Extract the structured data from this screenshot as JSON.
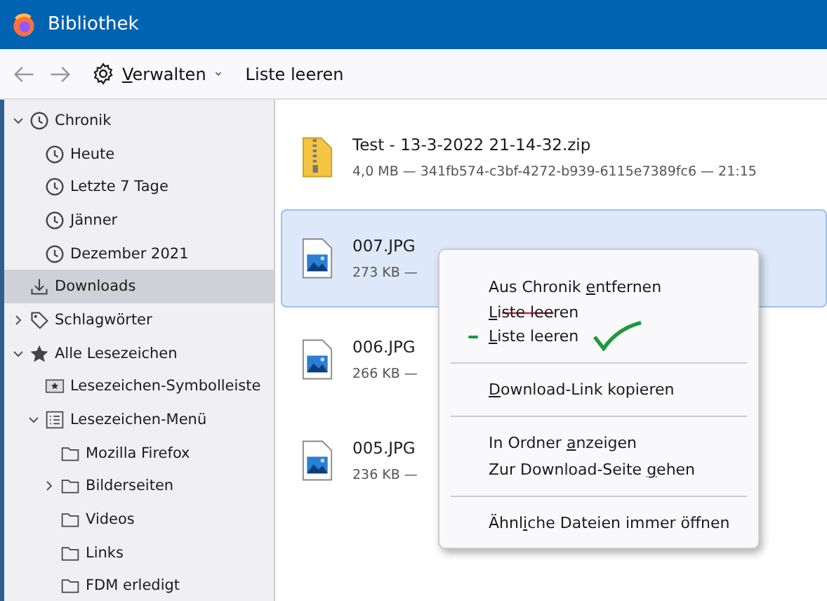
{
  "window": {
    "title": "Bibliothek"
  },
  "toolbar": {
    "back_disabled": true,
    "forward_disabled": true,
    "manage": {
      "key": "V",
      "after": "erwalten"
    },
    "clear": "Liste leeren"
  },
  "sidebar": {
    "items": [
      {
        "label": "Chronik",
        "kind": "clock",
        "expanded": true,
        "selected": false,
        "children": [
          {
            "label": "Heute",
            "kind": "clock",
            "selected": false
          },
          {
            "label": "Letzte 7 Tage",
            "kind": "clock",
            "selected": false
          },
          {
            "label": "Jänner",
            "kind": "clock",
            "selected": false
          },
          {
            "label": "Dezember 2021",
            "kind": "clock",
            "selected": false
          }
        ]
      },
      {
        "label": "Downloads",
        "kind": "download",
        "selected": true
      },
      {
        "label": "Schlagwörter",
        "kind": "tag",
        "expanded": false,
        "selected": false
      },
      {
        "label": "Alle Lesezeichen",
        "kind": "star",
        "expanded": true,
        "selected": false,
        "children": [
          {
            "label": "Lesezeichen-Symbolleiste",
            "kind": "toolbar",
            "selected": false
          },
          {
            "label": "Lesezeichen-Menü",
            "kind": "menu",
            "expanded": true,
            "selected": false,
            "children": [
              {
                "label": "Mozilla Firefox",
                "kind": "folder",
                "selected": false
              },
              {
                "label": "Bilderseiten",
                "kind": "folder",
                "expanded": false,
                "selected": false
              },
              {
                "label": "Videos",
                "kind": "folder",
                "selected": false
              },
              {
                "label": "Links",
                "kind": "folder",
                "selected": false
              },
              {
                "label": "FDM erledigt",
                "kind": "folder",
                "selected": false
              }
            ]
          }
        ]
      }
    ]
  },
  "downloads": [
    {
      "name": "Test - 13-3-2022 21-14-32.zip",
      "details": "4,0 MB — 341fb574-c3bf-4272-b939-6115e7389fc6 — 21:15",
      "kind": "zip",
      "selected": false
    },
    {
      "name": "007.JPG",
      "details": "273 KB —",
      "kind": "image",
      "selected": true
    },
    {
      "name": "006.JPG",
      "details": "266 KB —",
      "kind": "image",
      "selected": false
    },
    {
      "name": "005.JPG",
      "details": "236 KB —",
      "kind": "image",
      "selected": false
    }
  ],
  "context_menu": {
    "items": [
      {
        "kind": "item",
        "before": "Aus Chronik ",
        "key": "e",
        "after": "ntfernen"
      },
      {
        "kind": "struck_item",
        "key": "L",
        "after": "iste leeren"
      },
      {
        "kind": "approved_item",
        "key": "L",
        "after": "iste leeren"
      },
      {
        "kind": "separator"
      },
      {
        "kind": "item",
        "key": "D",
        "after": "ownload-Link kopieren"
      },
      {
        "kind": "separator"
      },
      {
        "kind": "item",
        "before": "In Ordner ",
        "key": "a",
        "after": "nzeigen"
      },
      {
        "kind": "item",
        "before": "Zur Download-Seite ",
        "key": "g",
        "after": "ehen"
      },
      {
        "kind": "separator"
      },
      {
        "kind": "item",
        "before": "Ähnl",
        "key": "i",
        "after": "che Dateien immer öffnen"
      }
    ]
  }
}
